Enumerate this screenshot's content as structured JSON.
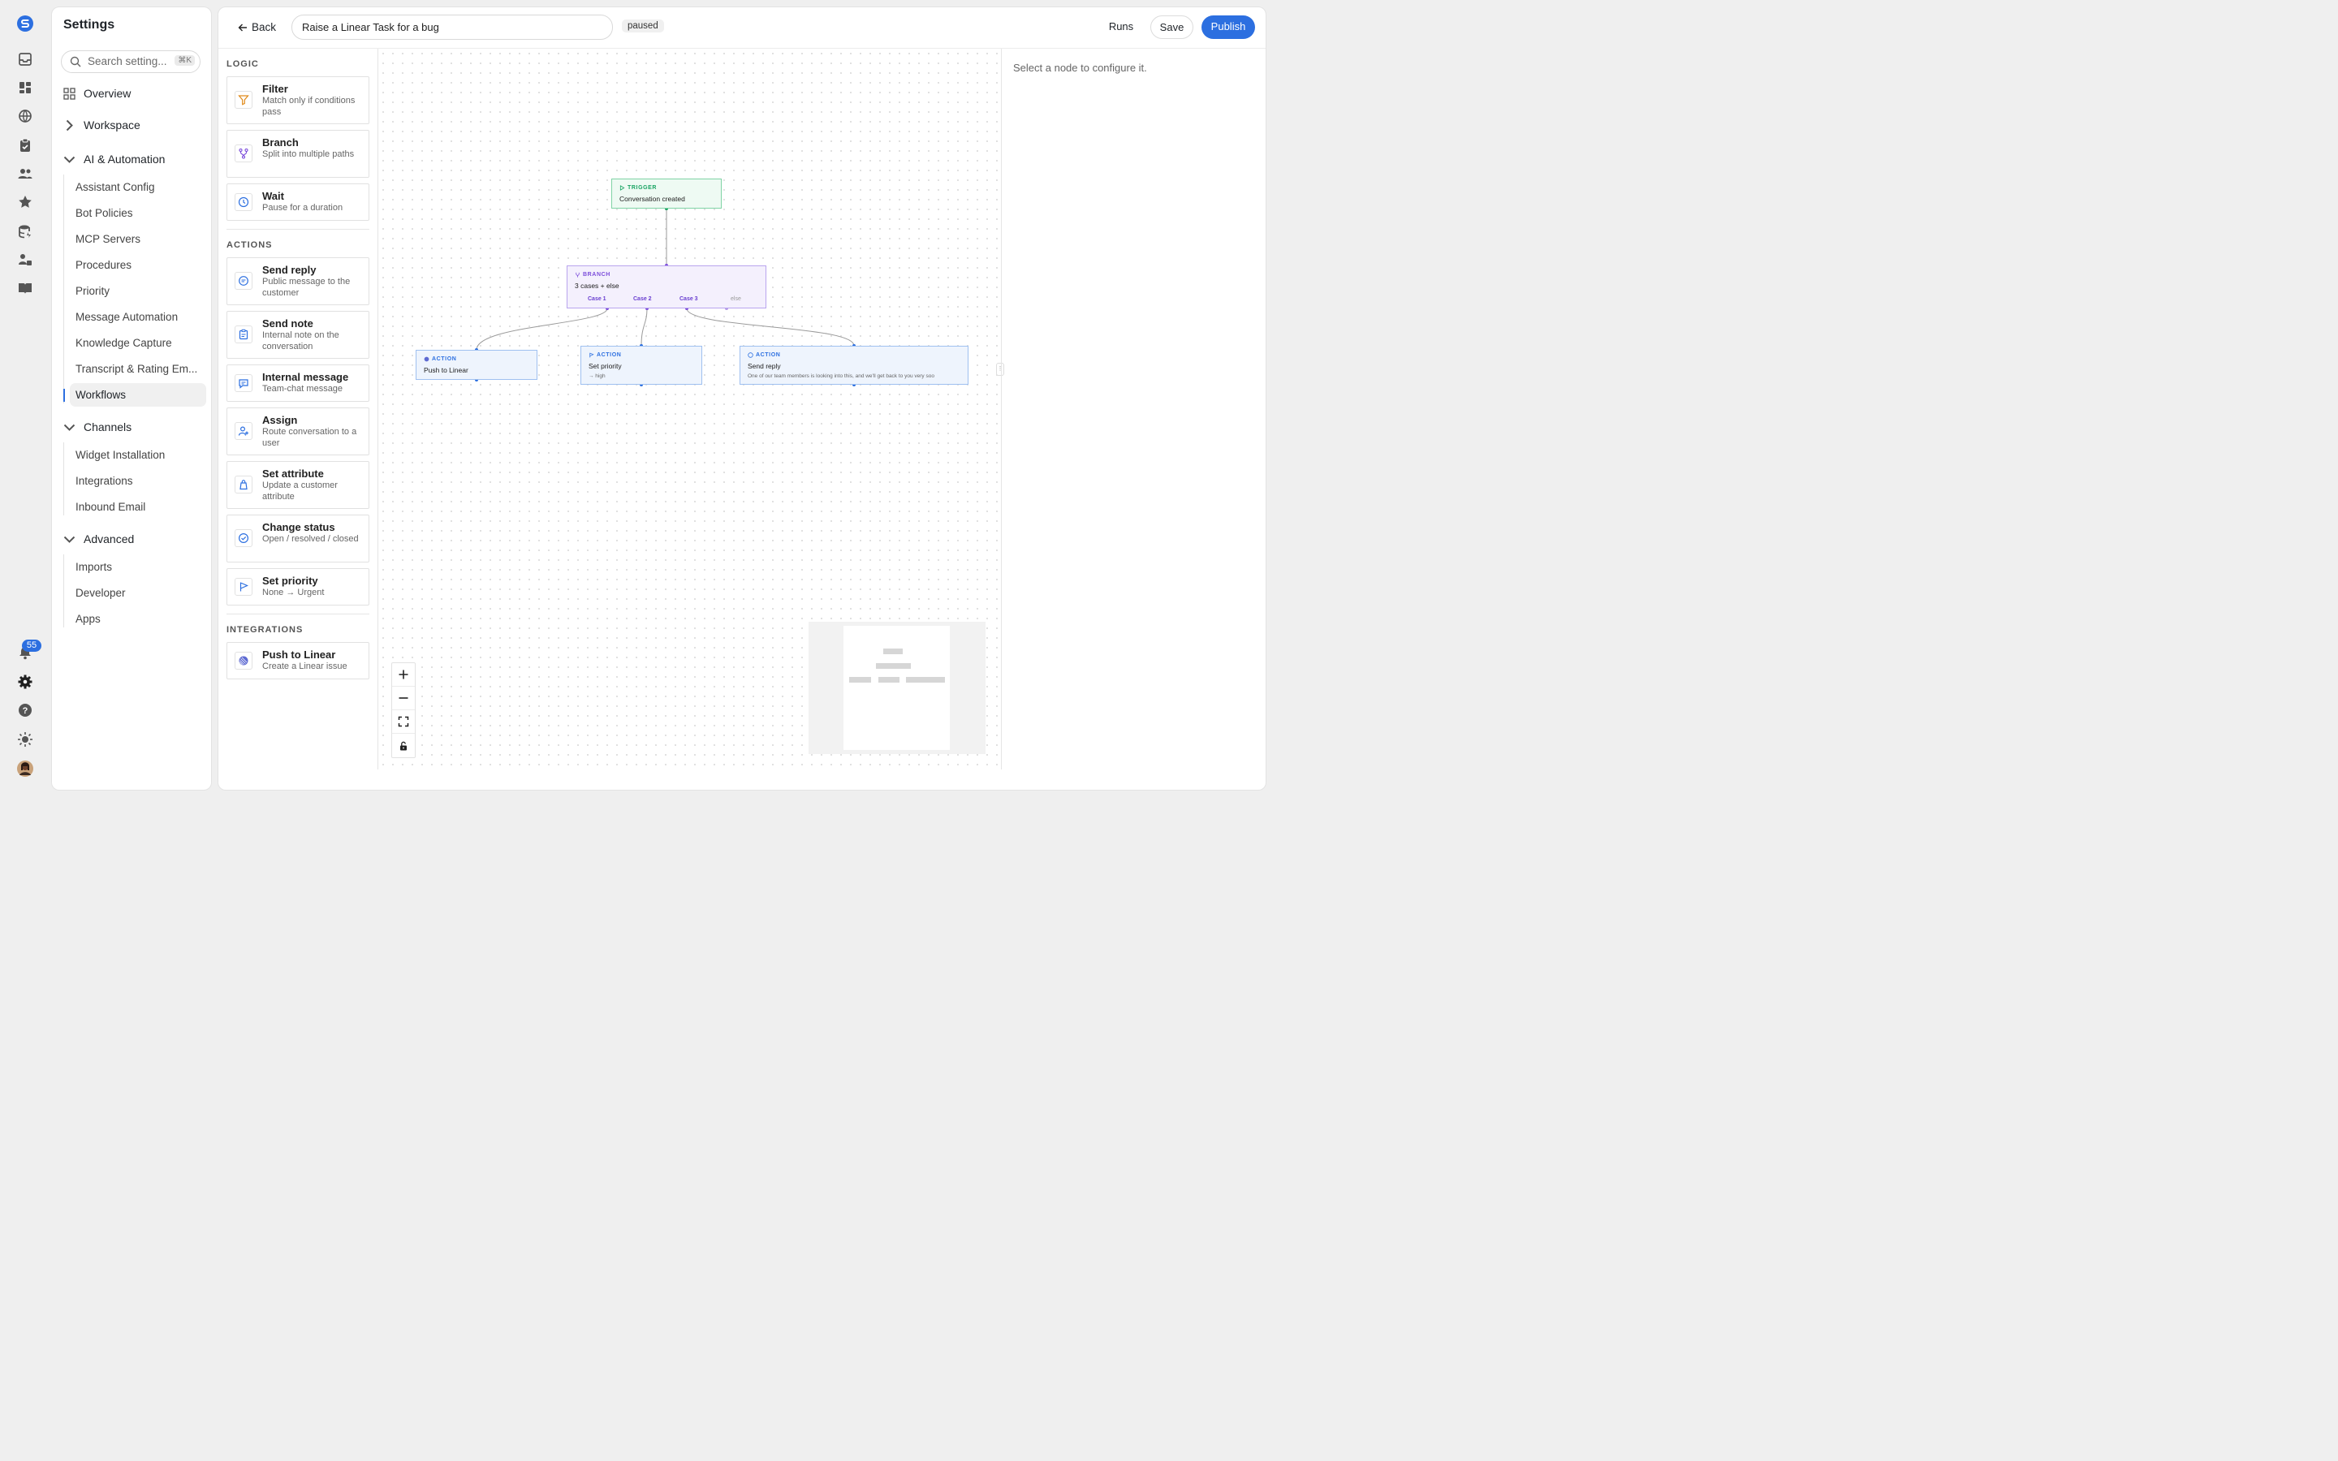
{
  "rail": {
    "icons": [
      "app-logo-icon",
      "inbox-icon",
      "dashboard-icon",
      "globe-icon",
      "clipboard-icon",
      "users-icon",
      "star-icon",
      "database-icon",
      "team-icon",
      "book-icon"
    ],
    "notification_count": "55",
    "bottom_icons": [
      "bell-icon",
      "gear-icon",
      "help-icon",
      "theme-icon",
      "avatar"
    ]
  },
  "settings": {
    "title": "Settings",
    "search": {
      "placeholder": "Search setting...",
      "shortcut": "⌘K"
    },
    "overview": "Overview",
    "workspace": "Workspace",
    "ai_automation": {
      "label": "AI & Automation",
      "items": [
        "Assistant Config",
        "Bot Policies",
        "MCP Servers",
        "Procedures",
        "Priority",
        "Message Automation",
        "Knowledge Capture",
        "Transcript & Rating Em...",
        "Workflows"
      ]
    },
    "channels": {
      "label": "Channels",
      "items": [
        "Widget Installation",
        "Integrations",
        "Inbound Email"
      ]
    },
    "advanced": {
      "label": "Advanced",
      "items": [
        "Imports",
        "Developer",
        "Apps"
      ]
    },
    "active_item": "Workflows"
  },
  "topbar": {
    "back_label": "Back",
    "workflow_name": "Raise a Linear Task for a bug",
    "status": "paused",
    "runs_label": "Runs",
    "save_label": "Save",
    "publish_label": "Publish"
  },
  "palette": {
    "logic": {
      "heading": "LOGIC",
      "items": [
        {
          "title": "Filter",
          "desc": "Match only if conditions pass",
          "icon": "filter-icon"
        },
        {
          "title": "Branch",
          "desc": "Split into multiple paths",
          "icon": "branch-icon"
        },
        {
          "title": "Wait",
          "desc": "Pause for a duration",
          "icon": "clock-icon"
        }
      ]
    },
    "actions": {
      "heading": "ACTIONS",
      "items": [
        {
          "title": "Send reply",
          "desc": "Public message to the customer",
          "icon": "chat-icon"
        },
        {
          "title": "Send note",
          "desc": "Internal note on the conversation",
          "icon": "note-icon"
        },
        {
          "title": "Internal message",
          "desc": "Team-chat message",
          "icon": "message-icon"
        },
        {
          "title": "Assign",
          "desc": "Route conversation to a user",
          "icon": "assign-icon"
        },
        {
          "title": "Set attribute",
          "desc": "Update a customer attribute",
          "icon": "tag-icon"
        },
        {
          "title": "Change status",
          "desc": "Open / resolved / closed",
          "icon": "check-circle-icon"
        },
        {
          "title": "Set priority",
          "desc": "None → Urgent",
          "icon": "flag-icon"
        }
      ]
    },
    "integrations": {
      "heading": "INTEGRATIONS",
      "items": [
        {
          "title": "Push to Linear",
          "desc": "Create a Linear issue",
          "icon": "linear-icon"
        }
      ]
    }
  },
  "canvas": {
    "trigger": {
      "kind": "TRIGGER",
      "title": "Conversation created"
    },
    "branch": {
      "kind": "BRANCH",
      "title": "3 cases + else",
      "cases": [
        "Case 1",
        "Case 2",
        "Case 3",
        "else"
      ]
    },
    "action_linear": {
      "kind": "ACTION",
      "title": "Push to Linear"
    },
    "action_priority": {
      "kind": "ACTION",
      "title": "Set priority",
      "sub": "→ high"
    },
    "action_reply": {
      "kind": "ACTION",
      "title": "Send reply",
      "sub": "One of our team members is looking into this, and we'll get back to you very soo"
    },
    "colors": {
      "trigger": "#19a463",
      "branch": "#7c4ddb",
      "action": "#2c6fe0"
    }
  },
  "config_panel": {
    "empty_message": "Select a node to configure it."
  }
}
